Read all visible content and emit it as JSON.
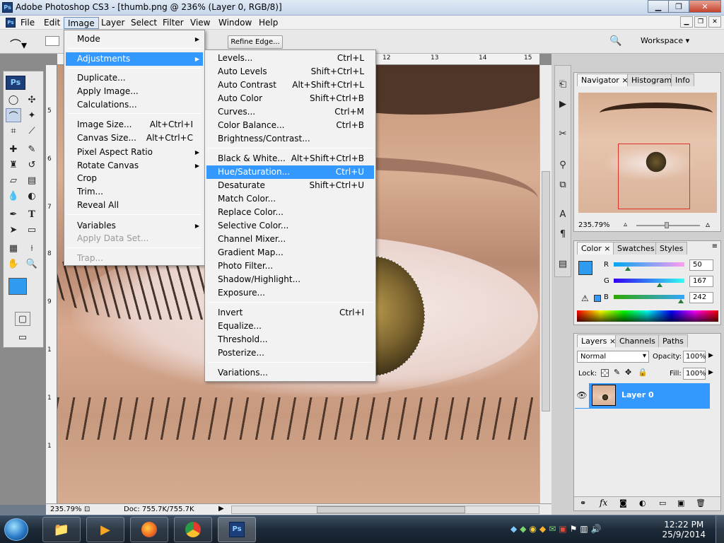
{
  "window": {
    "title": "Adobe Photoshop CS3 - [thumb.png @ 236% (Layer 0, RGB/8)]",
    "app_icon": "Ps"
  },
  "menubar": [
    "File",
    "Edit",
    "Image",
    "Layer",
    "Select",
    "Filter",
    "View",
    "Window",
    "Help"
  ],
  "options": {
    "refine_edge": "Refine Edge...",
    "workspace": "Workspace"
  },
  "rulers": {
    "top": [
      "12",
      "13",
      "14",
      "15"
    ],
    "left": [
      "5",
      "6",
      "7",
      "8",
      "9",
      "1",
      "1",
      "1"
    ]
  },
  "status": {
    "zoom": "235.79%",
    "doc": "Doc: 755.7K/755.7K"
  },
  "image_menu": {
    "items": [
      {
        "label": "Mode",
        "arrow": true
      },
      {
        "label": "Adjustments",
        "arrow": true,
        "highlighted": true
      },
      {
        "label": "Duplicate..."
      },
      {
        "label": "Apply Image..."
      },
      {
        "label": "Calculations..."
      },
      {
        "label": "Image Size...",
        "shortcut": "Alt+Ctrl+I"
      },
      {
        "label": "Canvas Size...",
        "shortcut": "Alt+Ctrl+C"
      },
      {
        "label": "Pixel Aspect Ratio",
        "arrow": true
      },
      {
        "label": "Rotate Canvas",
        "arrow": true
      },
      {
        "label": "Crop"
      },
      {
        "label": "Trim..."
      },
      {
        "label": "Reveal All"
      },
      {
        "label": "Variables",
        "arrow": true
      },
      {
        "label": "Apply Data Set...",
        "disabled": true
      },
      {
        "label": "Trap...",
        "disabled": true
      }
    ]
  },
  "adjust_menu": {
    "items": [
      {
        "label": "Levels...",
        "shortcut": "Ctrl+L"
      },
      {
        "label": "Auto Levels",
        "shortcut": "Shift+Ctrl+L"
      },
      {
        "label": "Auto Contrast",
        "shortcut": "Alt+Shift+Ctrl+L"
      },
      {
        "label": "Auto Color",
        "shortcut": "Shift+Ctrl+B"
      },
      {
        "label": "Curves...",
        "shortcut": "Ctrl+M"
      },
      {
        "label": "Color Balance...",
        "shortcut": "Ctrl+B"
      },
      {
        "label": "Brightness/Contrast..."
      },
      {
        "label": "Black & White...",
        "shortcut": "Alt+Shift+Ctrl+B"
      },
      {
        "label": "Hue/Saturation...",
        "shortcut": "Ctrl+U",
        "highlighted": true
      },
      {
        "label": "Desaturate",
        "shortcut": "Shift+Ctrl+U"
      },
      {
        "label": "Match Color..."
      },
      {
        "label": "Replace Color..."
      },
      {
        "label": "Selective Color..."
      },
      {
        "label": "Channel Mixer..."
      },
      {
        "label": "Gradient Map..."
      },
      {
        "label": "Photo Filter..."
      },
      {
        "label": "Shadow/Highlight..."
      },
      {
        "label": "Exposure..."
      },
      {
        "label": "Invert",
        "shortcut": "Ctrl+I"
      },
      {
        "label": "Equalize..."
      },
      {
        "label": "Threshold..."
      },
      {
        "label": "Posterize..."
      },
      {
        "label": "Variations..."
      }
    ]
  },
  "navigator": {
    "tabs": [
      "Navigator",
      "Histogram",
      "Info"
    ],
    "zoom": "235.79%"
  },
  "color_panel": {
    "tabs": [
      "Color",
      "Swatches",
      "Styles"
    ],
    "channels": [
      {
        "name": "R",
        "value": "50",
        "level": 0.2
      },
      {
        "name": "G",
        "value": "167",
        "level": 0.65
      },
      {
        "name": "B",
        "value": "242",
        "level": 0.95
      }
    ]
  },
  "layers_panel": {
    "tabs": [
      "Layers",
      "Channels",
      "Paths"
    ],
    "blend": "Normal",
    "opacity_label": "Opacity:",
    "opacity": "100%",
    "lock_label": "Lock:",
    "fill_label": "Fill:",
    "fill": "100%",
    "layer_name": "Layer 0"
  },
  "clock": {
    "time": "12:22 PM",
    "date": "25/9/2014"
  },
  "colors": {
    "accent": "#3399ff",
    "foreground": "#2f9bef"
  }
}
